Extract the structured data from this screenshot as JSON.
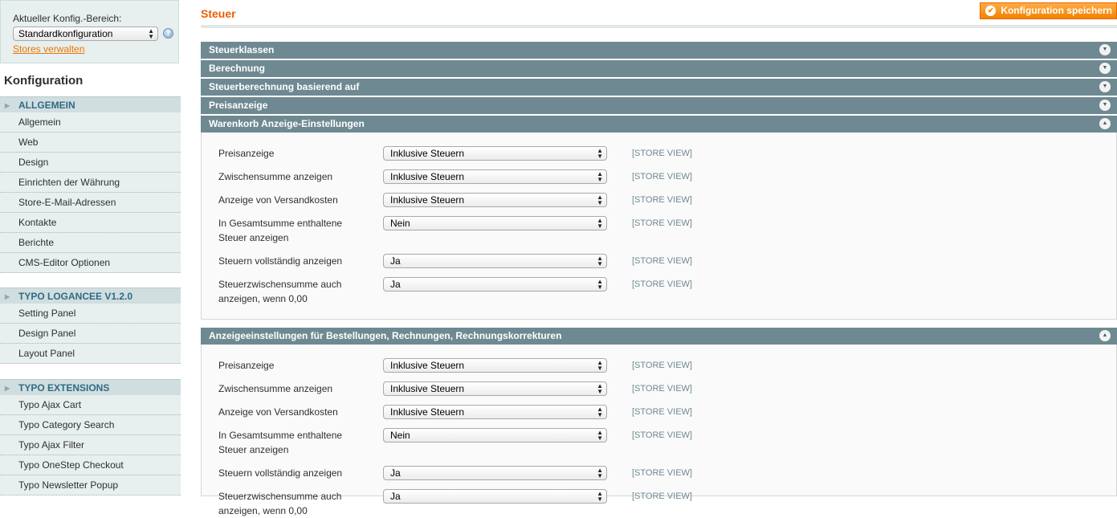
{
  "scope": {
    "label": "Aktueller Konfig.-Bereich:",
    "selected": "Standardkonfiguration",
    "help": "?",
    "manage_link": "Stores verwalten"
  },
  "sidebar": {
    "title": "Konfiguration",
    "groups": [
      {
        "title": "ALLGEMEIN",
        "items": [
          "Allgemein",
          "Web",
          "Design",
          "Einrichten der Währung",
          "Store-E-Mail-Adressen",
          "Kontakte",
          "Berichte",
          "CMS-Editor Optionen"
        ]
      },
      {
        "title": "TYPO LOGANCEE V1.2.0",
        "items": [
          "Setting Panel",
          "Design Panel",
          "Layout Panel"
        ]
      },
      {
        "title": "TYPO EXTENSIONS",
        "items": [
          "Typo Ajax Cart",
          "Typo Category Search",
          "Typo Ajax Filter",
          "Typo OneStep Checkout",
          "Typo Newsletter Popup"
        ]
      }
    ]
  },
  "main": {
    "title": "Steuer",
    "save_button": "Konfiguration speichern",
    "collapsed_sections": [
      "Steuerklassen",
      "Berechnung",
      "Steuerberechnung basierend auf",
      "Preisanzeige"
    ],
    "open_sections": [
      {
        "title": "Warenkorb Anzeige-Einstellungen",
        "rows": [
          {
            "label": "Preisanzeige",
            "value": "Inklusive Steuern",
            "scope": "[STORE VIEW]"
          },
          {
            "label": "Zwischensumme anzeigen",
            "value": "Inklusive Steuern",
            "scope": "[STORE VIEW]"
          },
          {
            "label": "Anzeige von Versandkosten",
            "value": "Inklusive Steuern",
            "scope": "[STORE VIEW]"
          },
          {
            "label": "In Gesamtsumme enthaltene Steuer anzeigen",
            "value": "Nein",
            "scope": "[STORE VIEW]"
          },
          {
            "label": "Steuern vollständig anzeigen",
            "value": "Ja",
            "scope": "[STORE VIEW]"
          },
          {
            "label": "Steuerzwischensumme auch anzeigen, wenn 0,00",
            "value": "Ja",
            "scope": "[STORE VIEW]"
          }
        ]
      },
      {
        "title": "Anzeigeeinstellungen für Bestellungen, Rechnungen, Rechnungskorrekturen",
        "rows": [
          {
            "label": "Preisanzeige",
            "value": "Inklusive Steuern",
            "scope": "[STORE VIEW]"
          },
          {
            "label": "Zwischensumme anzeigen",
            "value": "Inklusive Steuern",
            "scope": "[STORE VIEW]"
          },
          {
            "label": "Anzeige von Versandkosten",
            "value": "Inklusive Steuern",
            "scope": "[STORE VIEW]"
          },
          {
            "label": "In Gesamtsumme enthaltene Steuer anzeigen",
            "value": "Nein",
            "scope": "[STORE VIEW]"
          },
          {
            "label": "Steuern vollständig anzeigen",
            "value": "Ja",
            "scope": "[STORE VIEW]"
          },
          {
            "label": "Steuerzwischensumme auch anzeigen, wenn 0,00",
            "value": "Ja",
            "scope": "[STORE VIEW]"
          }
        ]
      }
    ]
  }
}
